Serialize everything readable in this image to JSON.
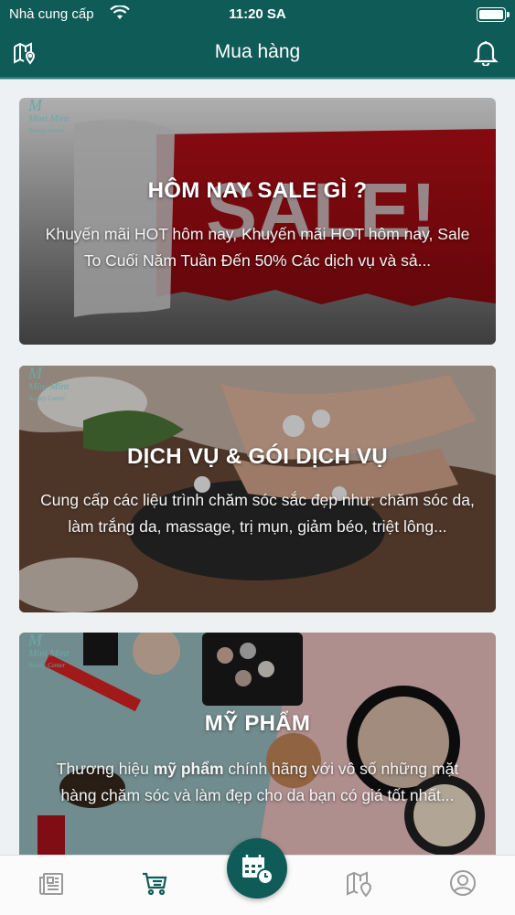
{
  "status_bar": {
    "carrier": "Nhà cung cấp",
    "time": "11:20 SA"
  },
  "header": {
    "title": "Mua hàng",
    "left_icon": "map-icon",
    "right_icon": "bell-icon"
  },
  "brand_logo": {
    "text": "Mini Mint",
    "sub": "Beauty Center"
  },
  "cards": [
    {
      "title": "HÔM NAY SALE GÌ ?",
      "description": "Khuyến mãi HOT hôm nay, Khuyến mãi HOT hôm nay, Sale To Cuối Năm Tuần Đến 50% Các dịch vụ và sả...",
      "image_text": "SALE!"
    },
    {
      "title": "DỊCH VỤ & GÓI DỊCH VỤ",
      "description": "Cung cấp các liệu trình chăm sóc sắc đẹp như: chăm sóc da, làm trắng da, massage, trị mụn, giảm béo, triệt lông..."
    },
    {
      "title": "MỸ PHẨM",
      "description_prefix": "Thương hiệu ",
      "description_bold": "mỹ phẩm",
      "description_suffix": " chính hãng với vô số những mặt hàng chăm sóc và làm đẹp cho da bạn có giá tốt nhất..."
    }
  ],
  "tabbar": {
    "items": [
      "news-icon",
      "cart-icon",
      "calendar-clock-icon",
      "map-icon",
      "profile-icon"
    ],
    "active": "cart-icon",
    "active_color": "#0f5b58"
  },
  "colors": {
    "primary": "#0f5b58",
    "sale_red": "#c8141c"
  }
}
